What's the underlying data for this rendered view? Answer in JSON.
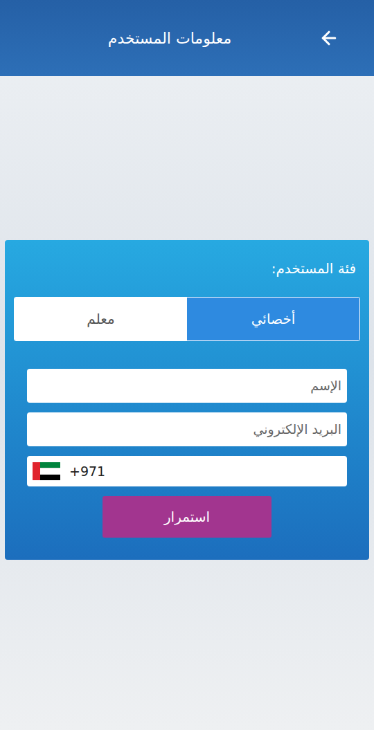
{
  "header": {
    "title": "معلومات المستخدم"
  },
  "form": {
    "category_label": "فئة المستخدم:",
    "tabs": [
      {
        "label": "أخصائي",
        "selected": true
      },
      {
        "label": "معلم",
        "selected": false
      }
    ],
    "fields": [
      {
        "placeholder": "الإسم"
      },
      {
        "placeholder": "البريد الإلكتروني"
      }
    ],
    "phone": {
      "code": "+971"
    },
    "submit": "استمرار"
  }
}
